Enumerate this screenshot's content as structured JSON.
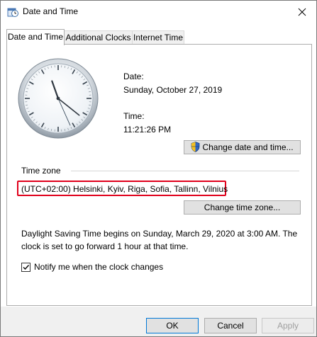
{
  "window": {
    "title": "Date and Time",
    "icon": "clock-calendar-icon",
    "close_icon": "close-icon"
  },
  "tabs": [
    {
      "label": "Date and Time",
      "active": true
    },
    {
      "label": "Additional Clocks",
      "active": false
    },
    {
      "label": "Internet Time",
      "active": false
    }
  ],
  "clock": {
    "time": "11:21:26"
  },
  "date_section": {
    "date_label": "Date:",
    "date_value": "Sunday, October 27, 2019",
    "time_label": "Time:",
    "time_value": "11:21:26 PM",
    "change_button": "Change date and time...",
    "change_button_icon": "uac-shield-icon"
  },
  "time_zone": {
    "legend": "Time zone",
    "value": "(UTC+02:00) Helsinki, Kyiv, Riga, Sofia, Tallinn, Vilnius",
    "change_button": "Change time zone...",
    "highlight_color": "#e0001b"
  },
  "dst": {
    "text": "Daylight Saving Time begins on Sunday, March 29, 2020 at 3:00 AM. The clock is set to go forward 1 hour at that time."
  },
  "notify": {
    "label": "Notify me when the clock changes",
    "checked": true
  },
  "footer": {
    "ok": "OK",
    "cancel": "Cancel",
    "apply": "Apply"
  }
}
